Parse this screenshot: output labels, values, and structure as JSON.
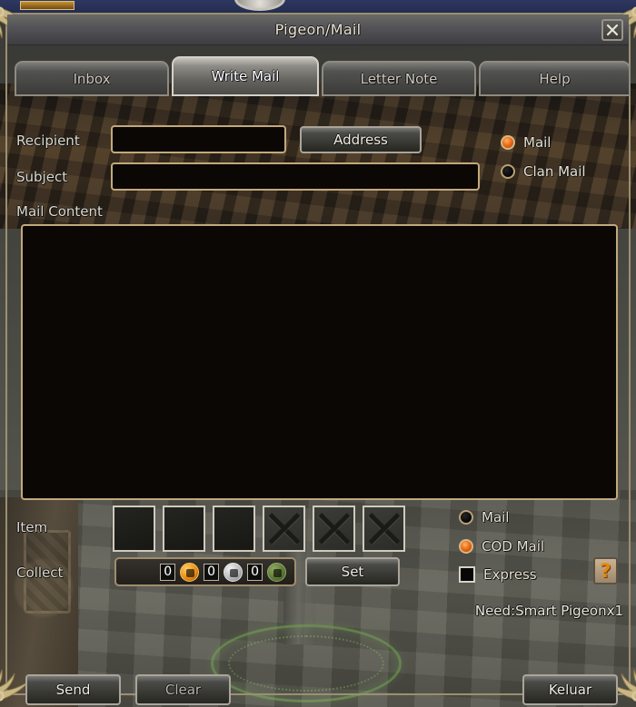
{
  "window": {
    "title": "Pigeon/Mail",
    "close_icon": "close-x-icon"
  },
  "tabs": [
    {
      "label": "Inbox",
      "active": false
    },
    {
      "label": "Write Mail",
      "active": true
    },
    {
      "label": "Letter Note",
      "active": false
    },
    {
      "label": "Help",
      "active": false
    }
  ],
  "form": {
    "recipient_label": "Recipient",
    "recipient_value": "",
    "recipient_placeholder": "",
    "address_button": "Address",
    "subject_label": "Subject",
    "subject_value": "",
    "subject_placeholder": "",
    "content_label": "Mail Content",
    "content_value": "",
    "content_placeholder": ""
  },
  "mail_type": {
    "options": [
      {
        "label": "Mail",
        "selected": true
      },
      {
        "label": "Clan Mail",
        "selected": false
      }
    ]
  },
  "attachments": {
    "item_label": "Item",
    "slots": [
      {
        "locked": false
      },
      {
        "locked": false
      },
      {
        "locked": false
      },
      {
        "locked": true
      },
      {
        "locked": true
      },
      {
        "locked": true
      }
    ]
  },
  "collect": {
    "label": "Collect",
    "coins": [
      {
        "amount": "0",
        "type": "gold-coin-icon"
      },
      {
        "amount": "0",
        "type": "silver-coin-icon"
      },
      {
        "amount": "0",
        "type": "bronze-coin-icon"
      }
    ],
    "set_button": "Set"
  },
  "delivery": {
    "options": [
      {
        "label": "Mail",
        "selected": false,
        "kind": "radio"
      },
      {
        "label": "COD Mail",
        "selected": true,
        "kind": "radio"
      },
      {
        "label": "Express",
        "selected": false,
        "kind": "checkbox"
      }
    ]
  },
  "help": {
    "glyph": "?",
    "icon": "question-mark-icon"
  },
  "requirement": {
    "text": "Need:Smart Pigeonx1"
  },
  "footer": {
    "send_button": "Send",
    "clear_button": "Clear",
    "exit_button": "Keluar"
  },
  "colors": {
    "accent_orange": "#ec6f18",
    "frame_gold": "#c2a97c",
    "border_tan": "#9b8f72",
    "text_cream": "#e6e0cf",
    "field_black": "#0b0705"
  }
}
